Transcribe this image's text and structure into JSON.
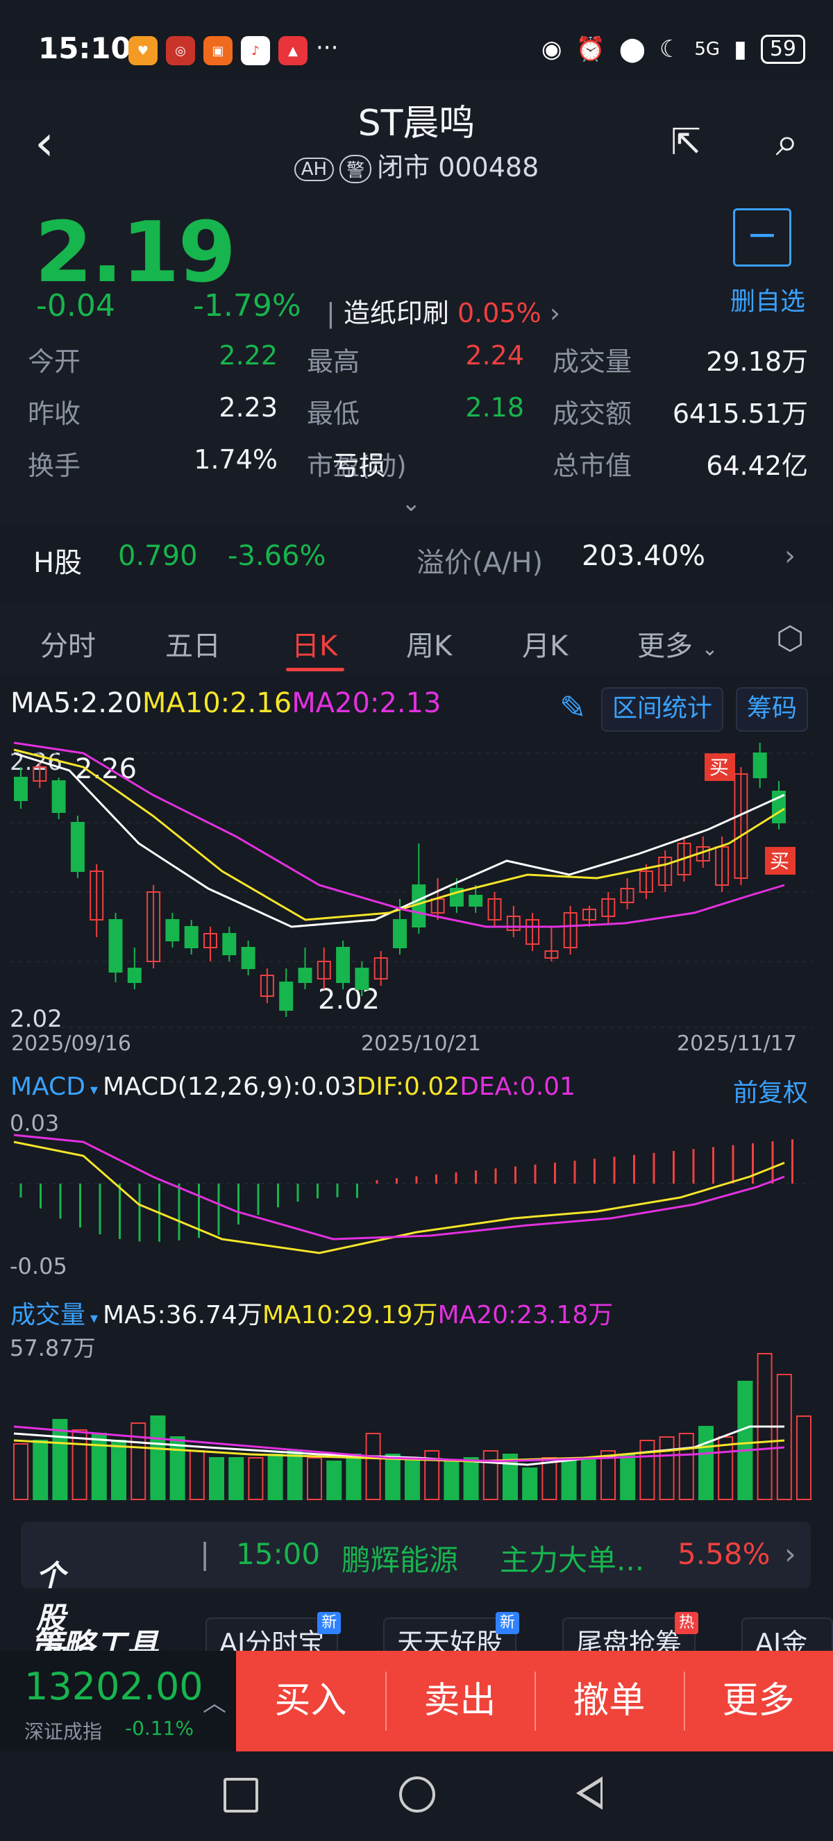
{
  "status": {
    "time": "15:10",
    "network": "5G",
    "battery": "59",
    "more": "···",
    "icons": [
      "eye-icon",
      "alarm-icon",
      "location-icon",
      "moon-icon",
      "signal-icon"
    ]
  },
  "header": {
    "title": "ST晨鸣",
    "badge_ah": "AH",
    "badge_warn": "警",
    "market_state": "闭市 000488"
  },
  "quote": {
    "price": "2.19",
    "change": "-0.04",
    "change_pct": "-1.79%",
    "sector_name": "造纸印刷",
    "sector_pct": "0.05%",
    "watch_label": "删自选",
    "rows": [
      [
        {
          "l": "今开",
          "v": "2.22",
          "c": "green"
        },
        {
          "l": "最高",
          "v": "2.24",
          "c": "red"
        },
        {
          "l": "成交量",
          "v": "29.18万",
          "c": "white"
        }
      ],
      [
        {
          "l": "昨收",
          "v": "2.23",
          "c": "white"
        },
        {
          "l": "最低",
          "v": "2.18",
          "c": "green"
        },
        {
          "l": "成交额",
          "v": "6415.51万",
          "c": "white"
        }
      ],
      [
        {
          "l": "换手",
          "v": "1.74%",
          "c": "white"
        },
        {
          "l": "市盈(动)",
          "v": "亏损",
          "c": "white"
        },
        {
          "l": "总市值",
          "v": "64.42亿",
          "c": "white"
        }
      ]
    ]
  },
  "hshare": {
    "label": "H股",
    "price": "0.790",
    "pct": "-3.66%",
    "premium_label": "溢价(A/H)",
    "premium": "203.40%"
  },
  "tabs": [
    "分时",
    "五日",
    "日K",
    "周K",
    "月K",
    "更多"
  ],
  "active_tab": "日K",
  "ma": {
    "ma5": "MA5:2.20",
    "ma10": "MA10:2.16",
    "ma20": "MA20:2.13",
    "range_stats": "区间统计",
    "chips": "筹码"
  },
  "kline": {
    "max_label": "2.26",
    "min_label": "2.02",
    "high_note": "2.26",
    "low_note": "2.02",
    "dates": [
      "2025/09/16",
      "2025/10/21",
      "2025/11/17"
    ],
    "buy_mark": "买",
    "colors": {
      "up": "#f04040",
      "down": "#17b54d",
      "ma5": "#ffffff",
      "ma10": "#f5e52a",
      "ma20": "#e231e0"
    }
  },
  "macd": {
    "label": "MACD",
    "params": "MACD(12,26,9):0.03",
    "dif": "DIF:0.02",
    "dea": "DEA:0.01",
    "adjust": "前复权",
    "top": "0.03",
    "bottom": "-0.05"
  },
  "volume": {
    "label": "成交量",
    "ma5": "MA5:36.74万",
    "ma10": "MA10:29.19万",
    "ma20": "MA20:23.18万",
    "max": "57.87万"
  },
  "news": {
    "brand": "个股异动",
    "time": "15:00",
    "stock": "鹏辉能源",
    "event": "主力大单...",
    "value": "5.58%"
  },
  "tools": {
    "title": "策略工具",
    "items": [
      {
        "label": "AI分时宝",
        "tag": "新"
      },
      {
        "label": "天天好股",
        "tag": "新"
      },
      {
        "label": "尾盘抢筹",
        "tag": "热"
      },
      {
        "label": "AI金股",
        "tag": ""
      }
    ]
  },
  "index": {
    "value": "13202.00",
    "name": "深证成指",
    "change": "-0.11%"
  },
  "trade_buttons": [
    "买入",
    "卖出",
    "撤单",
    "更多"
  ]
}
